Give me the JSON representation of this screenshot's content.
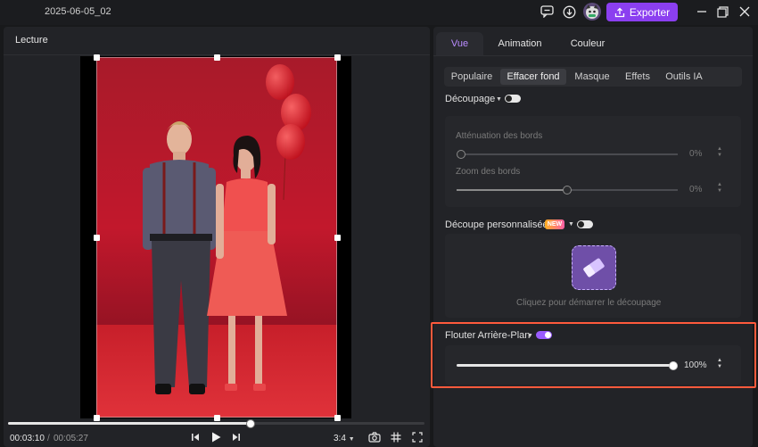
{
  "titlebar": {
    "project_title": "2025-06-05_02",
    "export_label": "Exporter",
    "icons": [
      "feedback-icon",
      "download-icon",
      "avatar",
      "export-upload-icon",
      "minimize-icon",
      "maximize-icon",
      "close-icon"
    ]
  },
  "player": {
    "title": "Lecture",
    "current_time": "00:03:10",
    "separator": "/",
    "total_time": "00:05:27",
    "progress": 0.58,
    "aspect_ratio": "3:4"
  },
  "tabs": [
    {
      "label": "Vue",
      "active": true
    },
    {
      "label": "Animation",
      "active": false
    },
    {
      "label": "Couleur",
      "active": false
    }
  ],
  "subtabs": [
    {
      "label": "Populaire",
      "active": false
    },
    {
      "label": "Effacer fond",
      "active": true
    },
    {
      "label": "Masque",
      "active": false
    },
    {
      "label": "Effets",
      "active": false
    },
    {
      "label": "Outils IA",
      "active": false
    }
  ],
  "decoupage": {
    "label": "Découpage",
    "enabled": false,
    "edge_fade": {
      "label": "Atténuation des bords",
      "value": "0%",
      "level": 0
    },
    "edge_zoom": {
      "label": "Zoom des bords",
      "value": "0%",
      "level": 0.5
    }
  },
  "custom_cutout": {
    "label": "Découpe personnalisée",
    "badge": "NEW",
    "enabled": false,
    "hint": "Cliquez pour démarrer le découpage"
  },
  "blur_background": {
    "label": "Flouter Arrière-Plan",
    "enabled": true,
    "value": "100%",
    "level": 1.0
  },
  "colors": {
    "accent": "#8b3ff0",
    "highlight": "#ff5a3c",
    "backdrop_red": "#c2182c"
  }
}
